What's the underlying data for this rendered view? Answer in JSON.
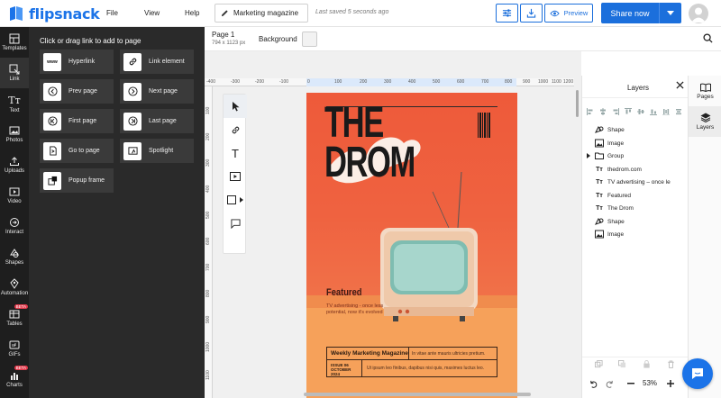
{
  "app": {
    "logo_text": "flipsnack",
    "menu": [
      "File",
      "View",
      "Help"
    ],
    "doc_title": "Marketing magazine",
    "saved_status": "Last saved 5 seconds ago",
    "preview_label": "Preview",
    "share_label": "Share now",
    "accent_color": "#1b6fdc"
  },
  "rail": [
    {
      "label": "Templates",
      "icon": "templates-icon"
    },
    {
      "label": "Link",
      "icon": "link-icon",
      "active": true
    },
    {
      "label": "Text",
      "icon": "text-icon"
    },
    {
      "label": "Photos",
      "icon": "photos-icon"
    },
    {
      "label": "Uploads",
      "icon": "uploads-icon"
    },
    {
      "label": "Video",
      "icon": "video-icon"
    },
    {
      "label": "Interact",
      "icon": "interact-icon"
    },
    {
      "label": "Shapes",
      "icon": "shapes-icon"
    },
    {
      "label": "Automation",
      "icon": "automation-icon"
    },
    {
      "label": "Tables",
      "icon": "tables-icon",
      "badge": "BETA"
    },
    {
      "label": "GIFs",
      "icon": "gifs-icon"
    },
    {
      "label": "Charts",
      "icon": "charts-icon",
      "badge": "BETA"
    }
  ],
  "link_panel": {
    "title": "Click or drag link to add to page",
    "items": [
      {
        "label": "Hyperlink",
        "icon": "www-icon"
      },
      {
        "label": "Link element",
        "icon": "link-element-icon"
      },
      {
        "label": "Prev page",
        "icon": "prev-page-icon"
      },
      {
        "label": "Next page",
        "icon": "next-page-icon"
      },
      {
        "label": "First page",
        "icon": "first-page-icon"
      },
      {
        "label": "Last page",
        "icon": "last-page-icon"
      },
      {
        "label": "Go to page",
        "icon": "go-to-page-icon"
      },
      {
        "label": "Spotlight",
        "icon": "spotlight-icon"
      },
      {
        "label": "Popup frame",
        "icon": "popup-frame-icon"
      }
    ]
  },
  "page_bar": {
    "page_name": "Page 1",
    "page_size": "794 x 1123 px",
    "background_label": "Background"
  },
  "ruler": {
    "top": [
      "-400",
      "-300",
      "-200",
      "-100",
      "0",
      "100",
      "200",
      "300",
      "400",
      "500",
      "600",
      "700",
      "800",
      "900",
      "1000",
      "1100",
      "1200"
    ],
    "left": [
      "100",
      "200",
      "300",
      "400",
      "500",
      "600",
      "700",
      "800",
      "900",
      "1000",
      "1100"
    ]
  },
  "magazine": {
    "title_line1": "THE",
    "title_line2": "DROM",
    "featured": "Featured",
    "featured_sub": "TV advertising - once less potential, now it's evolved",
    "footer_weekly": "Weekly Marketing Magazine",
    "footer_intro": "In vitae ante mauris ultricies pretium.",
    "footer_issue": "ISSUE 06 OCTOBER 2024",
    "footer_body": "Ut ipsum leo finibus, dapibus nisi quis, maximes luctus leo."
  },
  "layers": {
    "title": "Layers",
    "items": [
      {
        "name": "Shape",
        "icon": "shape-icon"
      },
      {
        "name": "Image",
        "icon": "image-icon"
      },
      {
        "name": "Group",
        "icon": "folder-icon",
        "expandable": true
      },
      {
        "name": "thedrom.com",
        "icon": "text-layer-icon"
      },
      {
        "name": "TV advertising – once le",
        "icon": "text-layer-icon"
      },
      {
        "name": "Featured",
        "icon": "text-layer-icon"
      },
      {
        "name": "The Drom",
        "icon": "text-layer-icon"
      },
      {
        "name": "Shape",
        "icon": "shape-icon"
      },
      {
        "name": "Image",
        "icon": "image-icon"
      }
    ],
    "zoom": "53%"
  },
  "right_tabs": [
    {
      "label": "Pages",
      "icon": "pages-icon"
    },
    {
      "label": "Layers",
      "icon": "layers-icon",
      "active": true
    }
  ]
}
